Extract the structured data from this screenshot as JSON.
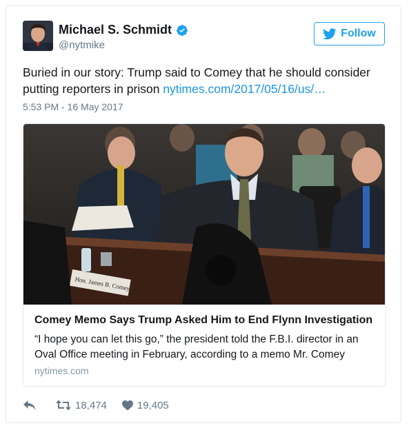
{
  "author": {
    "display_name": "Michael S. Schmidt",
    "handle": "@nytmike",
    "verified": true
  },
  "follow_button": {
    "label": "Follow",
    "icon": "twitter-bird-icon"
  },
  "tweet": {
    "text": "Buried in our story: Trump said to Comey that he should consider putting reporters in prison ",
    "link_text": "nytimes.com/2017/05/16/us/…",
    "timestamp": "5:53 PM - 16 May 2017"
  },
  "card": {
    "image_caption_plate": "Hon. James B. Comey, Jr.",
    "title": "Comey Memo Says Trump Asked Him to End Flynn Investigation",
    "description": "“I hope you can let this go,” the president told the F.B.I. director in an Oval Office meeting in February, according to a memo Mr. Comey",
    "domain": "nytimes.com"
  },
  "actions": {
    "reply_icon": "reply-icon",
    "retweet_icon": "retweet-icon",
    "retweet_count": "18,474",
    "like_icon": "heart-icon",
    "like_count": "19,405"
  },
  "colors": {
    "accent": "#1da1f2",
    "link": "#1b95e0",
    "muted": "#657786",
    "border": "#e1e8ed"
  }
}
